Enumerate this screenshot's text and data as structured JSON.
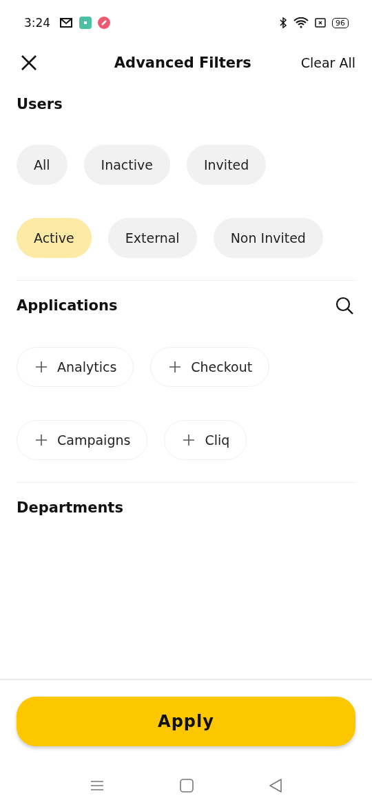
{
  "status_bar": {
    "time": "3:24",
    "battery": "96"
  },
  "header": {
    "title": "Advanced Filters",
    "action": "Clear All"
  },
  "sections": [
    {
      "title": "Users",
      "kind": "choice",
      "search": false,
      "rows": [
        [
          {
            "label": "All",
            "selected": false
          },
          {
            "label": "Inactive",
            "selected": false
          },
          {
            "label": "Invited",
            "selected": false
          }
        ],
        [
          {
            "label": "Active",
            "selected": true
          },
          {
            "label": "External",
            "selected": false
          },
          {
            "label": "Non Invited",
            "selected": false
          }
        ]
      ]
    },
    {
      "title": "Applications",
      "kind": "add",
      "search": true,
      "rows": [
        [
          {
            "label": "Analytics"
          },
          {
            "label": "Checkout"
          }
        ],
        [
          {
            "label": "Campaigns"
          },
          {
            "label": "Cliq"
          }
        ]
      ]
    },
    {
      "title": "Departments",
      "search": false
    }
  ],
  "apply_button": "Apply"
}
